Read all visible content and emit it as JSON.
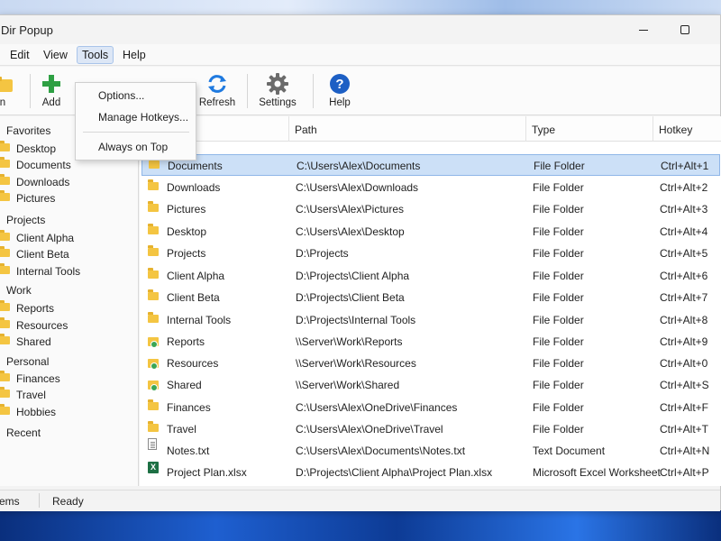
{
  "window": {
    "title": "Dir Popup"
  },
  "menubar": {
    "items": [
      {
        "label": "Edit"
      },
      {
        "label": "View"
      },
      {
        "label": "Tools"
      },
      {
        "label": "Help"
      }
    ]
  },
  "toolbar": {
    "items": [
      {
        "label": "n",
        "icon": "folder-icon"
      },
      {
        "label": "Add",
        "icon": "plus-icon"
      },
      {
        "label": "Refresh",
        "icon": "refresh-icon"
      },
      {
        "label": "Settings",
        "icon": "gear-icon"
      },
      {
        "label": "Help",
        "icon": "help-icon"
      }
    ]
  },
  "tools_menu": {
    "items": [
      {
        "label": "Options..."
      },
      {
        "label": "Manage Hotkeys..."
      },
      {
        "label": "Always on Top"
      }
    ]
  },
  "sidebar": {
    "groups": [
      {
        "label": "Favorites",
        "items": [
          "Desktop",
          "Documents",
          "Downloads",
          "Pictures"
        ]
      },
      {
        "label": "Projects",
        "items": [
          "Client Alpha",
          "Client Beta",
          "Internal Tools"
        ]
      },
      {
        "label": "Work",
        "items": [
          "Reports",
          "Resources",
          "Shared"
        ]
      },
      {
        "label": "Personal",
        "items": [
          "Finances",
          "Travel",
          "Hobbies"
        ]
      },
      {
        "label": "Recent",
        "items": []
      }
    ]
  },
  "list": {
    "columns": [
      "Path",
      "Type",
      "Hotkey"
    ],
    "rows": [
      {
        "name": "Documents",
        "path": "C:\\Users\\Alex\\Documents",
        "type": "File Folder",
        "hotkey": "Ctrl+Alt+1",
        "icon": "folder-icon",
        "selected": true
      },
      {
        "name": "Downloads",
        "path": "C:\\Users\\Alex\\Downloads",
        "type": "File Folder",
        "hotkey": "Ctrl+Alt+2",
        "icon": "folder-icon"
      },
      {
        "name": "Pictures",
        "path": "C:\\Users\\Alex\\Pictures",
        "type": "File Folder",
        "hotkey": "Ctrl+Alt+3",
        "icon": "folder-icon"
      },
      {
        "name": "Desktop",
        "path": "C:\\Users\\Alex\\Desktop",
        "type": "File Folder",
        "hotkey": "Ctrl+Alt+4",
        "icon": "folder-icon"
      },
      {
        "name": "Projects",
        "path": "D:\\Projects",
        "type": "File Folder",
        "hotkey": "Ctrl+Alt+5",
        "icon": "folder-icon"
      },
      {
        "name": "Client Alpha",
        "path": "D:\\Projects\\Client Alpha",
        "type": "File Folder",
        "hotkey": "Ctrl+Alt+6",
        "icon": "folder-icon"
      },
      {
        "name": "Client Beta",
        "path": "D:\\Projects\\Client Beta",
        "type": "File Folder",
        "hotkey": "Ctrl+Alt+7",
        "icon": "folder-icon"
      },
      {
        "name": "Internal Tools",
        "path": "D:\\Projects\\Internal Tools",
        "type": "File Folder",
        "hotkey": "Ctrl+Alt+8",
        "icon": "folder-icon"
      },
      {
        "name": "Reports",
        "path": "\\\\Server\\Work\\Reports",
        "type": "File Folder",
        "hotkey": "Ctrl+Alt+9",
        "icon": "network-folder-icon"
      },
      {
        "name": "Resources",
        "path": "\\\\Server\\Work\\Resources",
        "type": "File Folder",
        "hotkey": "Ctrl+Alt+0",
        "icon": "network-folder-icon"
      },
      {
        "name": "Shared",
        "path": "\\\\Server\\Work\\Shared",
        "type": "File Folder",
        "hotkey": "Ctrl+Alt+S",
        "icon": "network-folder-icon"
      },
      {
        "name": "Finances",
        "path": "C:\\Users\\Alex\\OneDrive\\Finances",
        "type": "File Folder",
        "hotkey": "Ctrl+Alt+F",
        "icon": "folder-icon"
      },
      {
        "name": "Travel",
        "path": "C:\\Users\\Alex\\OneDrive\\Travel",
        "type": "File Folder",
        "hotkey": "Ctrl+Alt+T",
        "icon": "folder-icon"
      },
      {
        "name": "Notes.txt",
        "path": "C:\\Users\\Alex\\Documents\\Notes.txt",
        "type": "Text Document",
        "hotkey": "Ctrl+Alt+N",
        "icon": "text-file-icon"
      },
      {
        "name": "Project Plan.xlsx",
        "path": "D:\\Projects\\Client Alpha\\Project Plan.xlsx",
        "type": "Microsoft Excel Worksheet",
        "hotkey": "Ctrl+Alt+P",
        "icon": "excel-file-icon"
      }
    ]
  },
  "statusbar": {
    "left": "ems",
    "right": "Ready"
  },
  "colors": {
    "accent": "#cce0f7",
    "selection_border": "#8fb6e8",
    "folder": "#f4c542",
    "add_icon": "#2ea043",
    "refresh_icon": "#1f7ae0",
    "help_icon": "#1d5fc4"
  }
}
